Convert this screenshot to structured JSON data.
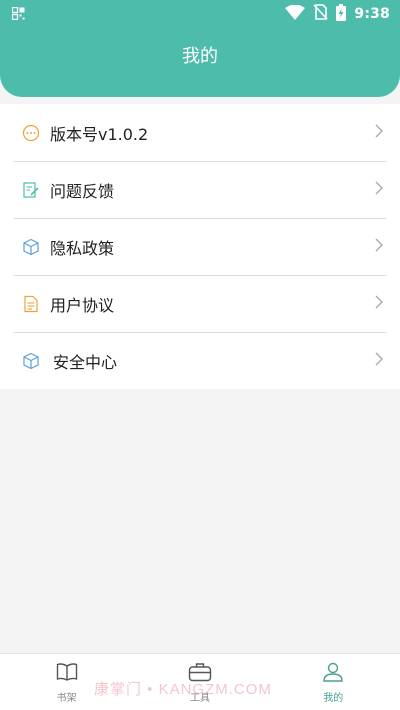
{
  "status_bar": {
    "time": "9:38",
    "icons": [
      "qr-scan-icon",
      "wifi-icon",
      "no-sim-icon",
      "battery-charging-icon"
    ]
  },
  "header": {
    "title": "我的"
  },
  "menu": {
    "items": [
      {
        "label": "版本号v1.0.2",
        "icon": "info-dots-icon"
      },
      {
        "label": "问题反馈",
        "icon": "feedback-edit-icon"
      },
      {
        "label": "隐私政策",
        "icon": "privacy-cube-icon"
      },
      {
        "label": "用户协议",
        "icon": "document-icon"
      },
      {
        "label": "安全中心",
        "icon": "security-cube-icon"
      }
    ]
  },
  "tabbar": {
    "tabs": [
      {
        "label": "书架",
        "icon": "book-icon",
        "active": false
      },
      {
        "label": "工具",
        "icon": "toolbox-icon",
        "active": false
      },
      {
        "label": "我的",
        "icon": "user-icon",
        "active": true
      }
    ]
  },
  "watermark": {
    "text": "康掌门 • KANGZM.COM"
  },
  "colors": {
    "accent": "#4ebcab",
    "active_tab": "#4a9f93",
    "icon_orange": "#f0a23c",
    "icon_green": "#4ebcab",
    "icon_blue": "#5aa0d8"
  }
}
